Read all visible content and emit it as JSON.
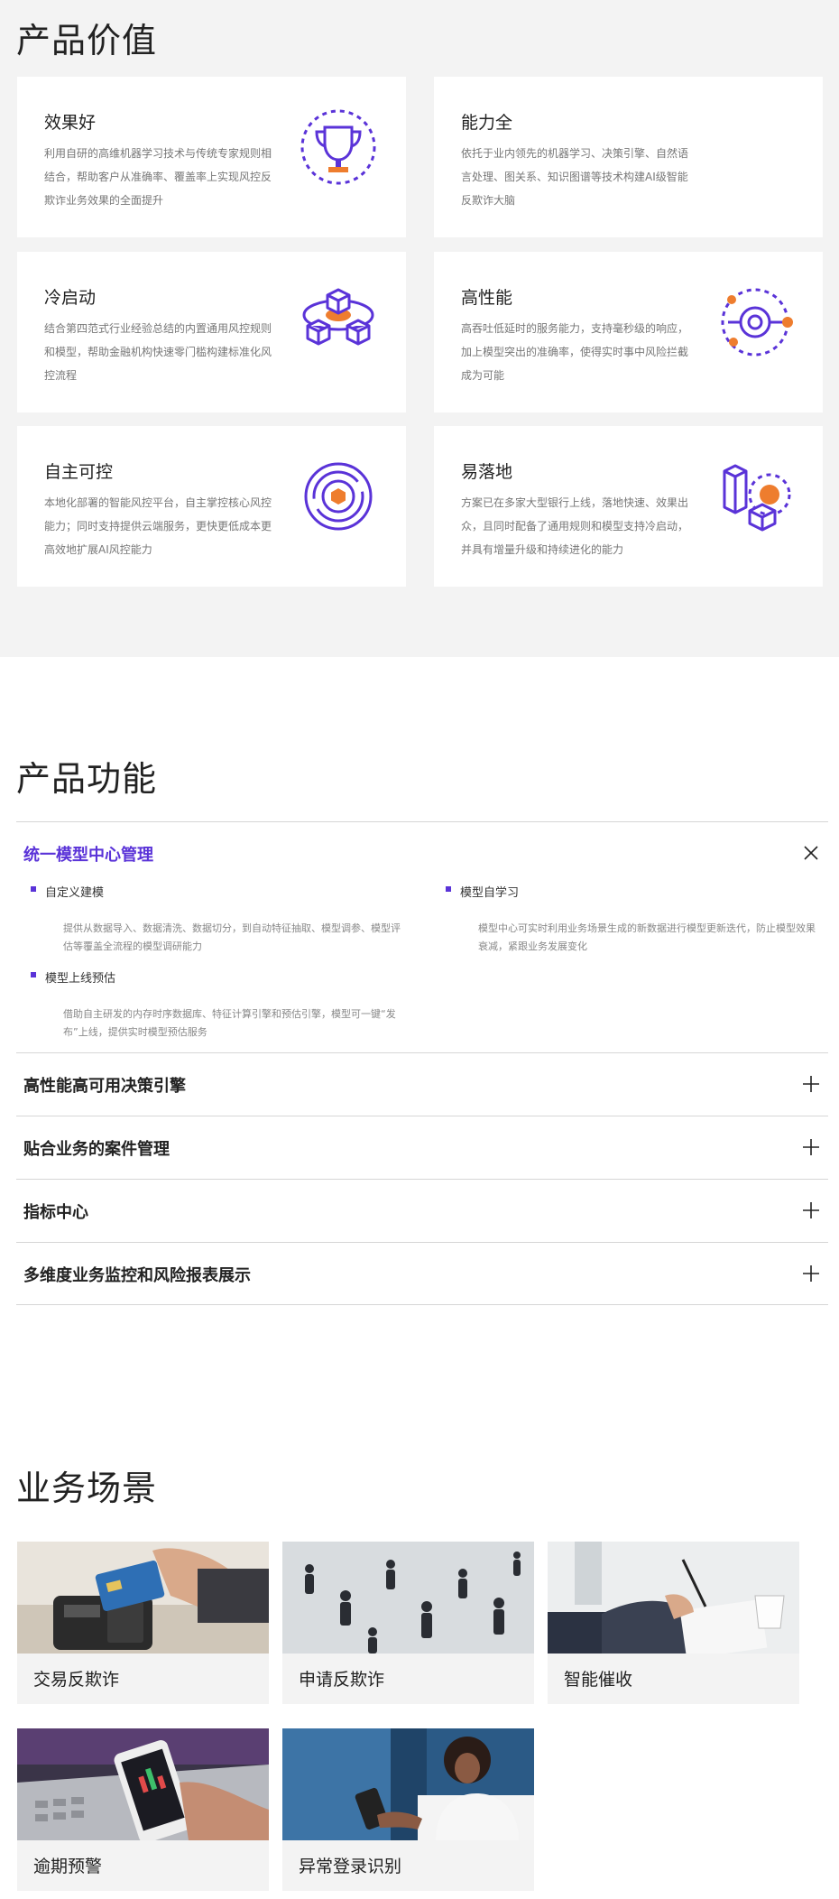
{
  "value": {
    "title": "产品价值",
    "cards": [
      {
        "title": "效果好",
        "desc": "利用自研的高维机器学习技术与传统专家规则相结合，帮助客户从准确率、覆盖率上实现风控反欺诈业务效果的全面提升",
        "icon": "trophy-icon"
      },
      {
        "title": "能力全",
        "desc": "依托于业内领先的机器学习、决策引擎、自然语言处理、图关系、知识图谱等技术构建AI级智能反欺诈大脑",
        "icon": "none"
      },
      {
        "title": "冷启动",
        "desc": "结合第四范式行业经验总结的内置通用风控规则和模型，帮助金融机构快速零门槛构建标准化风控流程",
        "icon": "cubes-icon"
      },
      {
        "title": "高性能",
        "desc": "高吞吐低延时的服务能力，支持毫秒级的响应，加上模型突出的准确率，使得实时事中风险拦截成为可能",
        "icon": "orbit-icon"
      },
      {
        "title": "自主可控",
        "desc": "本地化部署的智能风控平台，自主掌控核心风控能力；同时支持提供云端服务，更快更低成本更高效地扩展AI风控能力",
        "icon": "target-icon"
      },
      {
        "title": "易落地",
        "desc": "方案已在多家大型银行上线，落地快速、效果出众，且同时配备了通用规则和模型支持冷启动，并具有增量升级和持续进化的能力",
        "icon": "blocks-icon"
      }
    ]
  },
  "features": {
    "title": "产品功能",
    "items": [
      {
        "title": "统一模型中心管理",
        "expanded": true,
        "subs": [
          {
            "name": "自定义建模",
            "desc": "提供从数据导入、数据清洗、数据切分，到自动特征抽取、模型调参、模型评估等覆盖全流程的模型调研能力"
          },
          {
            "name": "模型自学习",
            "desc": "模型中心可实时利用业务场景生成的新数据进行模型更新迭代，防止模型效果衰减，紧跟业务发展变化"
          },
          {
            "name": "模型上线预估",
            "desc": "借助自主研发的内存时序数据库、特征计算引擎和预估引擎，模型可一键“发布”上线，提供实时模型预估服务"
          }
        ]
      },
      {
        "title": "高性能高可用决策引擎",
        "expanded": false
      },
      {
        "title": "贴合业务的案件管理",
        "expanded": false
      },
      {
        "title": "指标中心",
        "expanded": false
      },
      {
        "title": "多维度业务监控和风险报表展示",
        "expanded": false
      }
    ]
  },
  "scenes": {
    "title": "业务场景",
    "items": [
      {
        "label": "交易反欺诈"
      },
      {
        "label": "申请反欺诈"
      },
      {
        "label": "智能催收"
      },
      {
        "label": "逾期预警"
      },
      {
        "label": "异常登录识别"
      }
    ]
  },
  "colors": {
    "accent": "#5a33d8",
    "orange": "#ee7d2e",
    "card_bg": "#ffffff",
    "section_bg": "#f3f3f3"
  }
}
